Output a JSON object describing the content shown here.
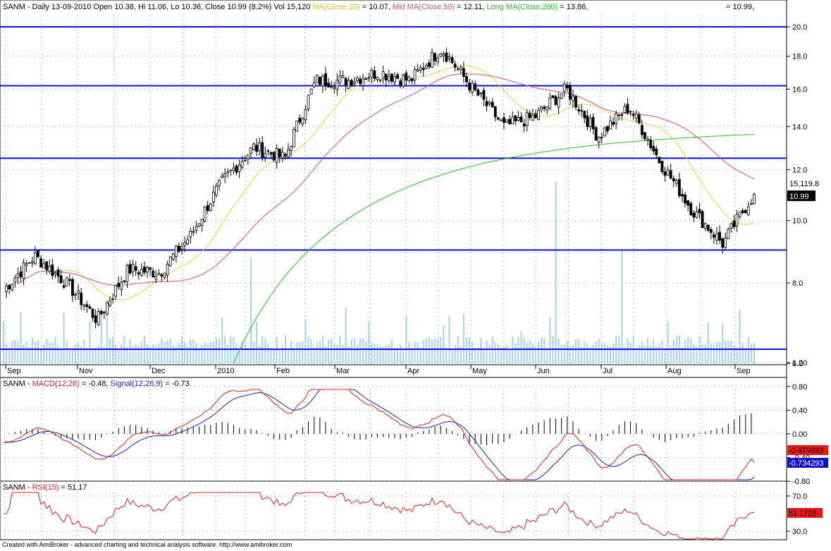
{
  "header": {
    "prefix": "SANM - Daily 13-09-2010 Open 10.38, Hi 11.06, Lo 10.36, Close 10.99 (8.2%) Vol 15,120",
    "ma_short_label": "MA(Close,20)",
    "ma_short_value": " = 10.07,",
    "ma_mid_label": "Mid MA(Close,50)",
    "ma_mid_value": " = 12.11,",
    "ma_long_label": "Long MA(Close,200)",
    "ma_long_value": " = 13.86,",
    "last_value": "= 10.99,"
  },
  "price_panel": {
    "y_ticks": [
      "20.0",
      "18.0",
      "16.0",
      "14.0",
      "12.0",
      "10.0",
      "8.0",
      "6.0"
    ],
    "x_labels": [
      "Sep",
      "Nov",
      "Dec",
      "2010",
      "Feb",
      "Mar",
      "Apr",
      "May",
      "Jun",
      "Jul",
      "Aug",
      "Sep"
    ],
    "volume_tag": "15,119.8",
    "close_tag": "10.99"
  },
  "macd_panel": {
    "title_prefix": "SANM - ",
    "macd_label": "MACD(12,26)",
    "macd_value": " = -0.48, ",
    "signal_label": "Signal(12,26,9)",
    "signal_value": " = -0.73",
    "y_ticks": [
      "1.20",
      "0.80",
      "0.40",
      "0.00",
      "-0.40",
      "-0.80"
    ],
    "macd_tag": "-0.479883",
    "signal_tag": "-0.734293"
  },
  "rsi_panel": {
    "title_prefix": "SANM - ",
    "rsi_label": "RSI(15)",
    "rsi_value": " = 51.17",
    "y_ticks": [
      "70.0",
      "30.0"
    ],
    "rsi_tag": "51.1728"
  },
  "footer": "Created with AmiBroker - advanced charting and technical analysis software. http://www.amibroker.com",
  "chart_data": [
    {
      "type": "candlestick",
      "title": "SANM - Daily",
      "y_scale": "log",
      "ylim": [
        6,
        20
      ],
      "support_resistance_lines": [
        20.0,
        16.2,
        12.5,
        9.0,
        6.4
      ],
      "series": [
        {
          "name": "MA(Close,20)",
          "color": "#e6d23c"
        },
        {
          "name": "Mid MA(Close,50)",
          "color": "#d8506e"
        },
        {
          "name": "Long MA(Close,200)",
          "color": "#22c322"
        }
      ],
      "x": [
        "Sep",
        "Nov",
        "Dec",
        "2010",
        "Feb",
        "Mar",
        "Apr",
        "May",
        "Jun",
        "Jul",
        "Aug",
        "Sep"
      ],
      "close_approx": [
        7.8,
        8.8,
        8.0,
        7.0,
        8.4,
        8.3,
        9.5,
        11.5,
        13.0,
        12.5,
        16.5,
        16.5,
        17.0,
        16.5,
        18.5,
        16.0,
        14.0,
        14.5,
        16.0,
        13.5,
        15.0,
        12.3,
        10.4,
        9.2,
        10.99
      ],
      "last_close": 10.99,
      "volume_color": "#a6d2f0"
    },
    {
      "type": "line",
      "title": "MACD(12,26)",
      "ylim": [
        -1.1,
        1.3
      ],
      "series": [
        {
          "name": "MACD(12,26)",
          "color": "#e02020",
          "last": -0.48
        },
        {
          "name": "Signal(12,26,9)",
          "color": "#1c1cd0",
          "last": -0.73
        }
      ]
    },
    {
      "type": "line",
      "title": "RSI(15)",
      "ylim": [
        20,
        85
      ],
      "series": [
        {
          "name": "RSI(15)",
          "color": "#e02020",
          "last": 51.17
        }
      ]
    }
  ]
}
